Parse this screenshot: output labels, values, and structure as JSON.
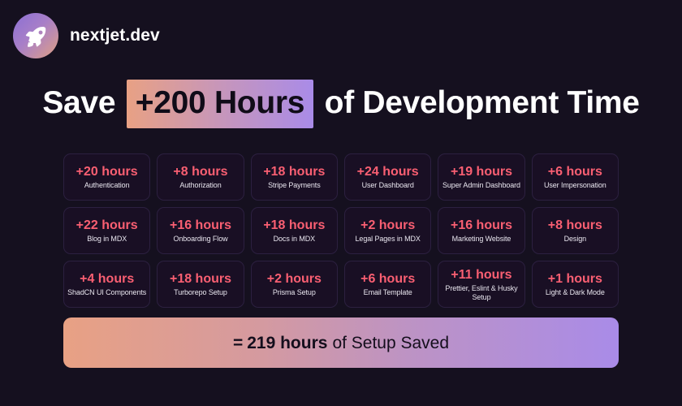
{
  "brand": {
    "logo_icon": "rocket-icon",
    "name": "nextjet.dev"
  },
  "headline": {
    "before": "Save",
    "highlight": "+200 Hours",
    "after": "of Development Time"
  },
  "colors": {
    "background": "#15101f",
    "card_background": "#190f24",
    "card_border": "#2c2040",
    "hours_accent": "#fa5f72",
    "gradient_start": "#e8a184",
    "gradient_end": "#a98be8",
    "banner_text": "#140e1c"
  },
  "cards": [
    {
      "hours": "+20 hours",
      "label": "Authentication"
    },
    {
      "hours": "+8 hours",
      "label": "Authorization"
    },
    {
      "hours": "+18 hours",
      "label": "Stripe Payments"
    },
    {
      "hours": "+24 hours",
      "label": "User Dashboard"
    },
    {
      "hours": "+19 hours",
      "label": "Super Admin Dashboard"
    },
    {
      "hours": "+6 hours",
      "label": "User Impersonation"
    },
    {
      "hours": "+22 hours",
      "label": "Blog in MDX"
    },
    {
      "hours": "+16 hours",
      "label": "Onboarding Flow"
    },
    {
      "hours": "+18 hours",
      "label": "Docs in MDX"
    },
    {
      "hours": "+2 hours",
      "label": "Legal Pages in MDX"
    },
    {
      "hours": "+16 hours",
      "label": "Marketing Website"
    },
    {
      "hours": "+8 hours",
      "label": "Design"
    },
    {
      "hours": "+4 hours",
      "label": "ShadCN UI Components"
    },
    {
      "hours": "+18 hours",
      "label": "Turborepo Setup"
    },
    {
      "hours": "+2 hours",
      "label": "Prisma Setup"
    },
    {
      "hours": "+6 hours",
      "label": "Email Template"
    },
    {
      "hours": "+11 hours",
      "label": "Prettier, Eslint & Husky Setup"
    },
    {
      "hours": "+1 hours",
      "label": "Light & Dark Mode"
    }
  ],
  "banner": {
    "equals": "=",
    "total": "219 hours",
    "tail": "of Setup Saved"
  }
}
